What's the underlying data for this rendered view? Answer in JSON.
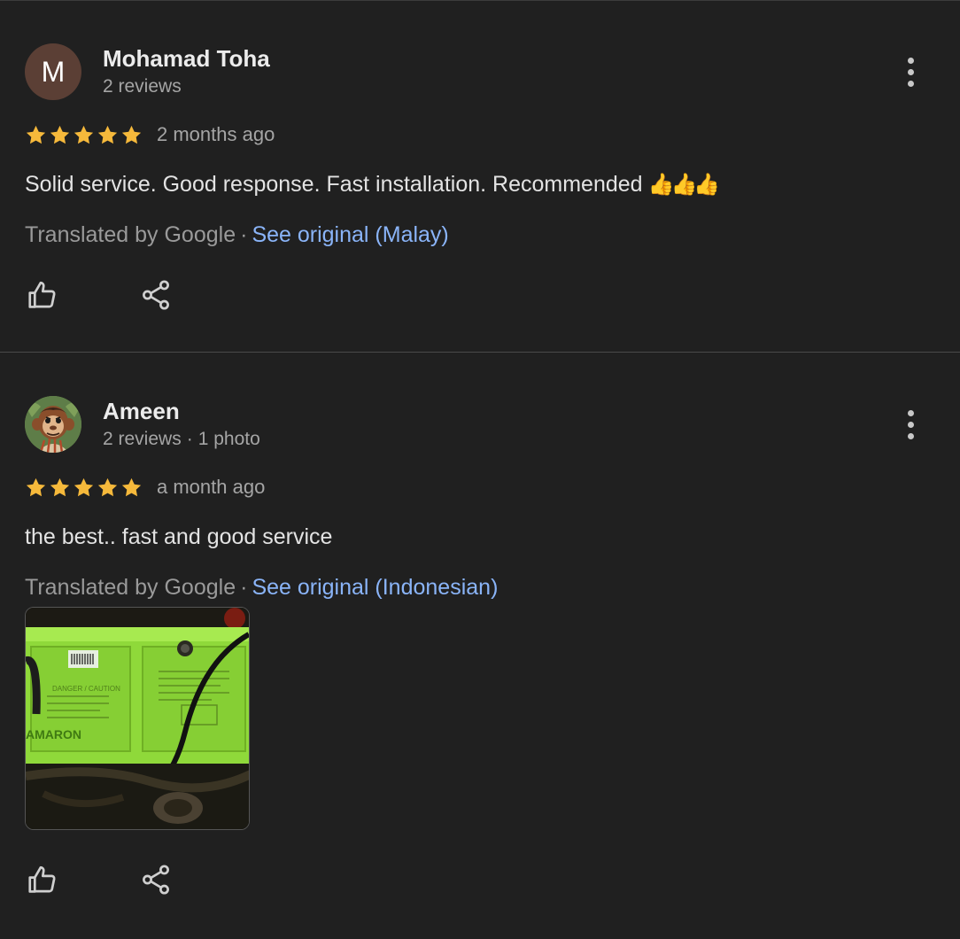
{
  "reviews": [
    {
      "avatar_letter": "M",
      "name": "Mohamad Toha",
      "reviews_count": "2 reviews",
      "rating": 5,
      "time": "2 months ago",
      "text": "Solid service. Good response. Fast installation. Recommended",
      "emoji": "👍👍👍",
      "translated_by": "Translated by Google",
      "separator": "·",
      "see_original": "See original (Malay)"
    },
    {
      "name": "Ameen",
      "reviews_count": "2 reviews",
      "photo_count": "1 photo",
      "meta_separator": "·",
      "rating": 5,
      "time": "a month ago",
      "text": "the best.. fast and good service",
      "translated_by": "Translated by Google",
      "separator": "·",
      "see_original": "See original (Indonesian)",
      "photo": {
        "brand_text": "AMARON",
        "label_text": "DANGER / CAUTION"
      }
    }
  ],
  "icons": {
    "more": "more-vert-icon",
    "like": "thumb-up-icon",
    "share": "share-icon",
    "star": "star-icon"
  },
  "colors": {
    "background": "#202020",
    "star": "#f6b93b",
    "link": "#8ab4f8",
    "avatar_bg": "#5b3f35",
    "battery_green": "#9be23a"
  }
}
